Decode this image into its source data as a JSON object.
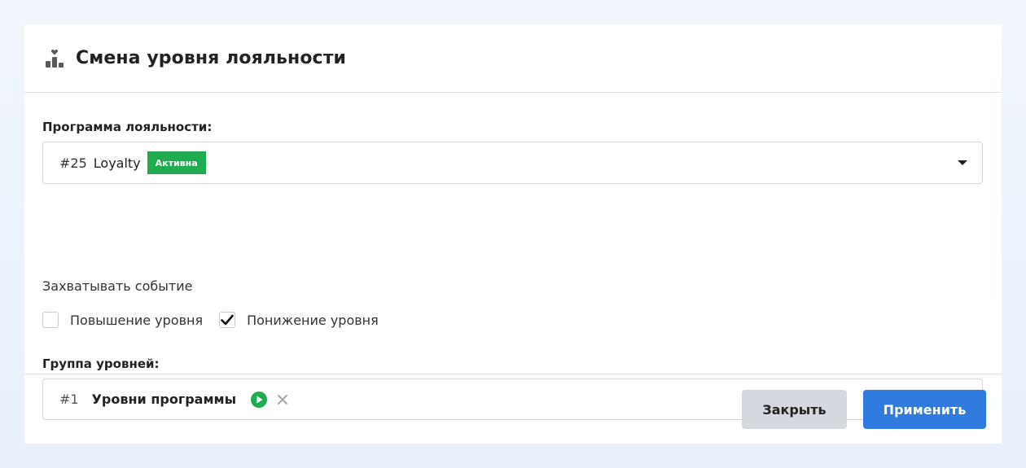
{
  "dialog": {
    "title": "Смена уровня лояльности",
    "icon": "leaderboard-heart-icon"
  },
  "loyalty_program": {
    "label": "Программа лояльности:",
    "selected_id": "#25",
    "selected_name": "Loyalty",
    "status_badge": "Активна",
    "badge_color": "#1fab4f"
  },
  "capture_event": {
    "label": "Захватывать событие",
    "options": [
      {
        "label": "Повышение уровня",
        "checked": false
      },
      {
        "label": "Понижение уровня",
        "checked": true
      }
    ]
  },
  "level_group": {
    "label": "Группа уровней:",
    "selected_id": "#1",
    "selected_name": "Уровни программы",
    "status_icon": "play-circle-icon",
    "status_color": "#1fab4f"
  },
  "footer": {
    "close_label": "Закрыть",
    "apply_label": "Применить",
    "apply_color": "#2f7be0"
  }
}
